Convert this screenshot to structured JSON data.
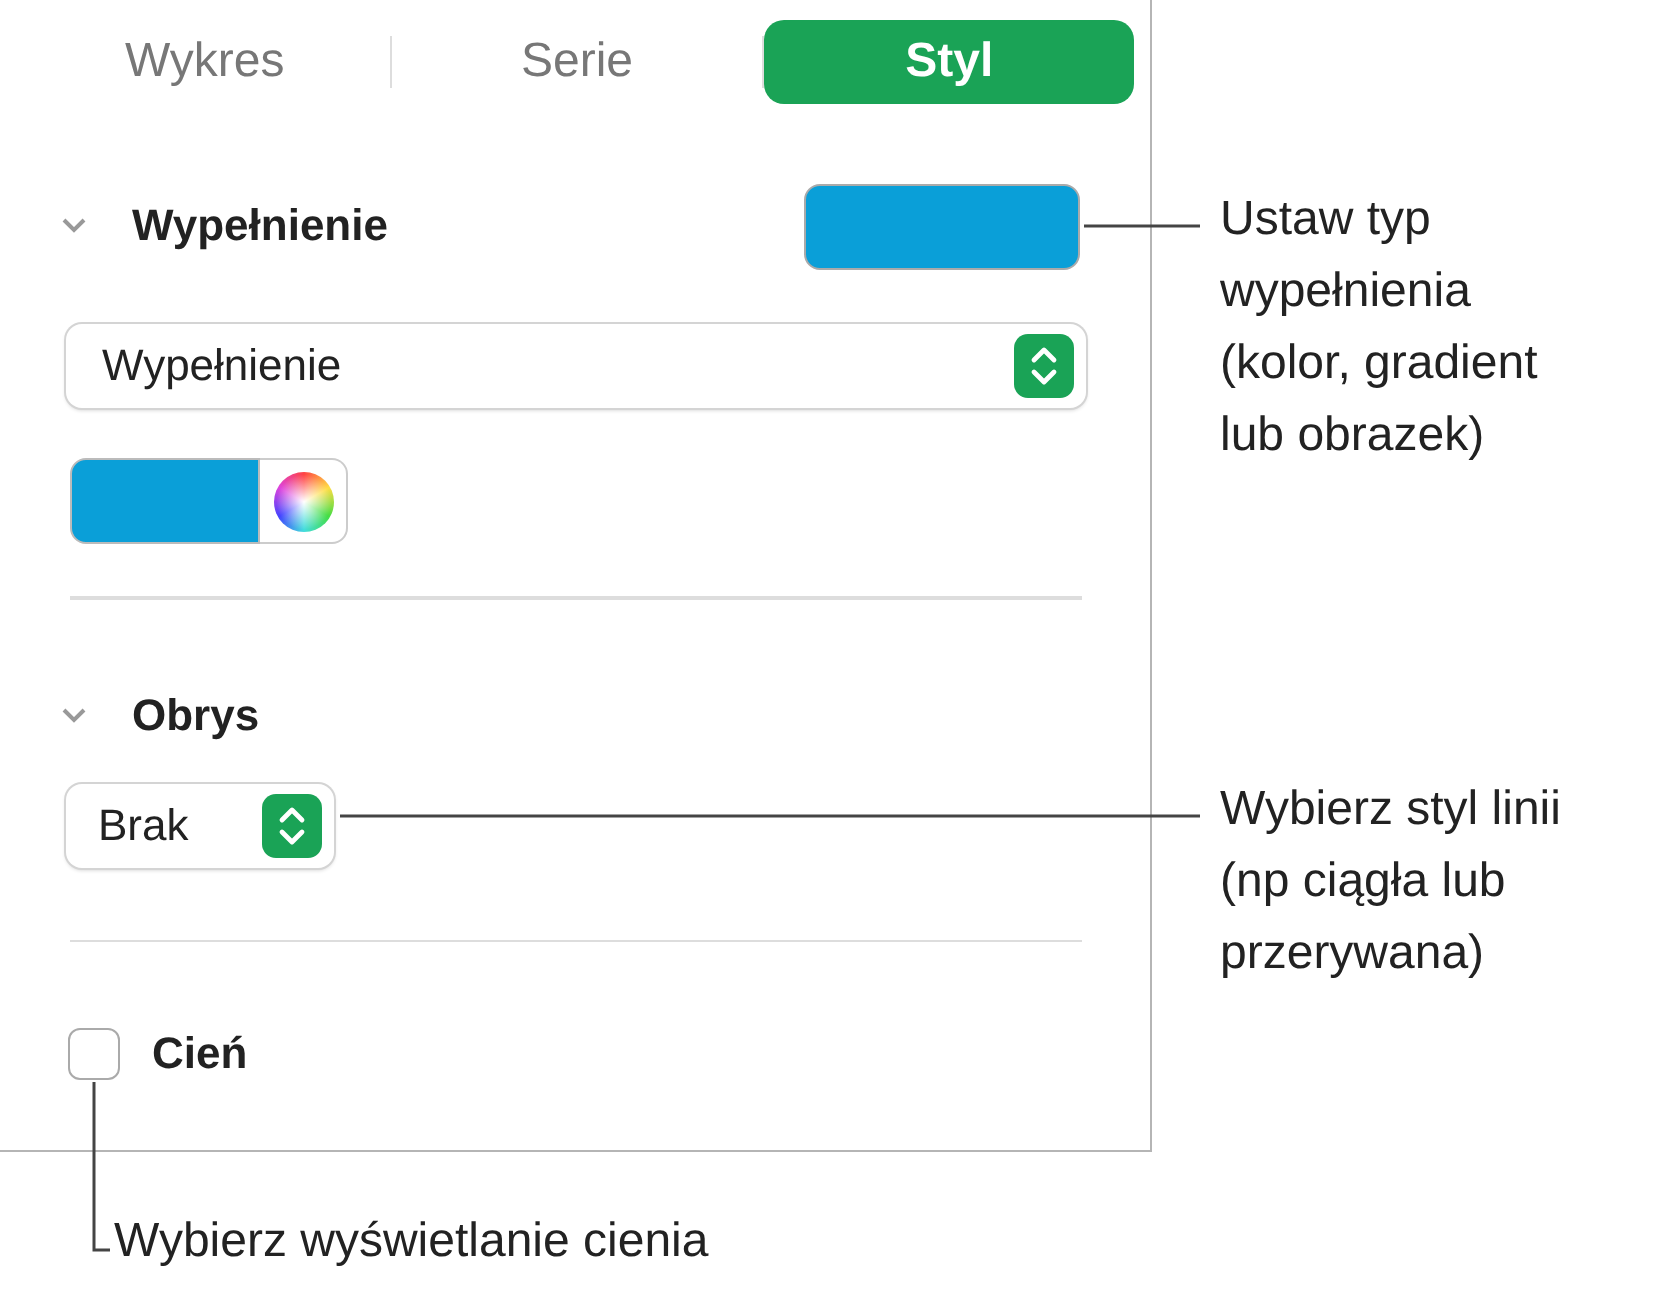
{
  "tabs": [
    {
      "label": "Wykres",
      "selected": false
    },
    {
      "label": "Serie",
      "selected": false
    },
    {
      "label": "Styl",
      "selected": true
    }
  ],
  "fill_section": {
    "title": "Wypełnienie",
    "expanded": true,
    "color": "#0a9fd8"
  },
  "fill_type": {
    "value": "Wypełnienie"
  },
  "fill_color": {
    "color": "#0a9fd8"
  },
  "outline_section": {
    "title": "Obrys",
    "expanded": true
  },
  "outline_style": {
    "value": "Brak"
  },
  "shadow": {
    "label": "Cień",
    "checked": false
  },
  "callouts": [
    {
      "lines": [
        "Ustaw typ",
        "wypełnienia",
        "(kolor, gradient",
        "lub obrazek)"
      ]
    },
    {
      "lines": [
        "Wybierz styl linii",
        "(np ciągła lub",
        "przerywana)"
      ]
    },
    {
      "lines": [
        "Wybierz wyświetlanie cienia"
      ]
    }
  ]
}
